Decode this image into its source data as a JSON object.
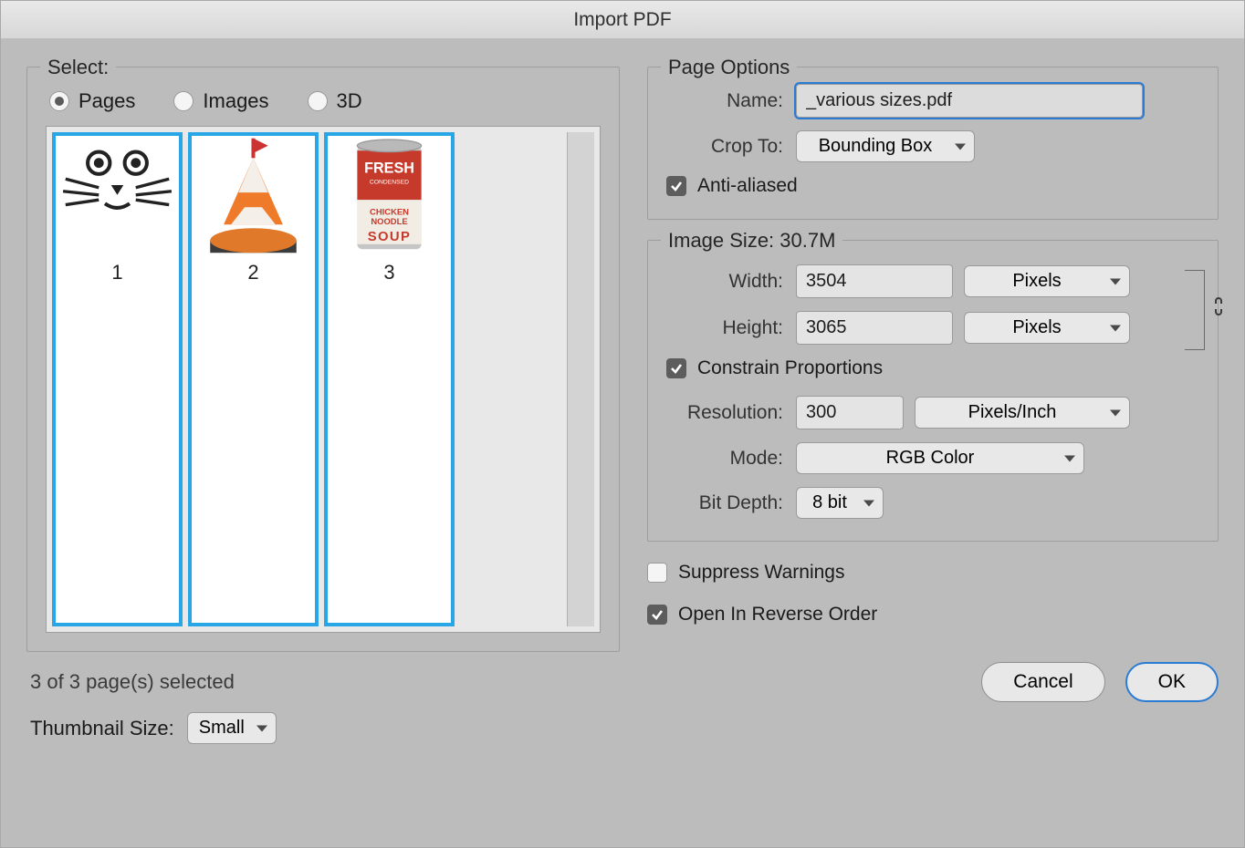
{
  "window": {
    "title": "Import PDF"
  },
  "select_panel": {
    "legend": "Select:",
    "radios": {
      "pages": "Pages",
      "images": "Images",
      "three_d": "3D",
      "selected": "pages"
    },
    "thumbs": [
      {
        "num": "1",
        "art": "cat"
      },
      {
        "num": "2",
        "art": "buoy"
      },
      {
        "num": "3",
        "art": "soup"
      }
    ],
    "selected_text": "3 of 3 page(s) selected",
    "thumb_size_label": "Thumbnail Size:",
    "thumb_size_value": "Small"
  },
  "page_options": {
    "legend": "Page Options",
    "name_label": "Name:",
    "name_value": "_various sizes.pdf",
    "crop_label": "Crop To:",
    "crop_value": "Bounding Box",
    "antialias_label": "Anti-aliased",
    "antialias_checked": true
  },
  "image_size": {
    "legend": "Image Size: 30.7M",
    "width_label": "Width:",
    "width_value": "3504",
    "width_units": "Pixels",
    "height_label": "Height:",
    "height_value": "3065",
    "height_units": "Pixels",
    "constrain_label": "Constrain Proportions",
    "constrain_checked": true,
    "resolution_label": "Resolution:",
    "resolution_value": "300",
    "resolution_units": "Pixels/Inch",
    "mode_label": "Mode:",
    "mode_value": "RGB Color",
    "bitdepth_label": "Bit Depth:",
    "bitdepth_value": "8 bit"
  },
  "footer": {
    "suppress_label": "Suppress Warnings",
    "suppress_checked": false,
    "reverse_label": "Open In Reverse Order",
    "reverse_checked": true,
    "cancel": "Cancel",
    "ok": "OK"
  }
}
